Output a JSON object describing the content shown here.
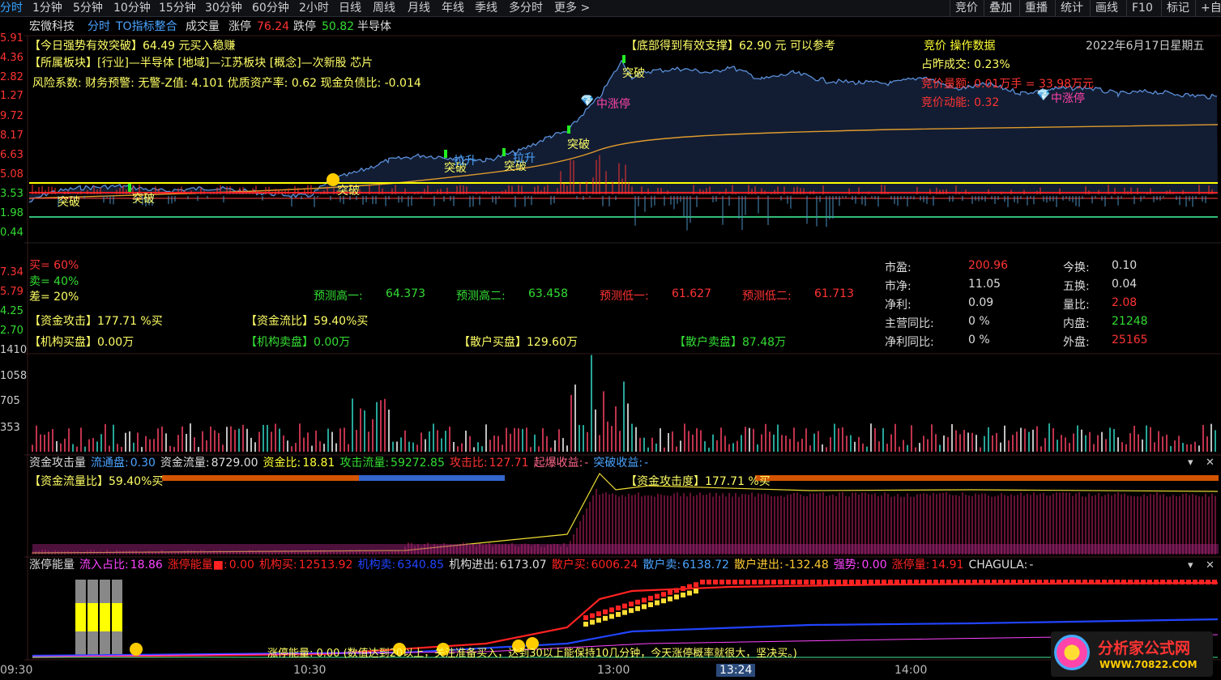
{
  "topbar": {
    "tabs": [
      "分时",
      "1分钟",
      "5分钟",
      "10分钟",
      "15分钟",
      "30分钟",
      "60分钟",
      "2小时",
      "日线",
      "周线",
      "月线",
      "年线",
      "季线",
      "多分时",
      "更多 >"
    ],
    "right_tools": [
      "竞价",
      "叠加",
      "重播",
      "统计",
      "画线",
      "F10",
      "标记",
      "+自"
    ]
  },
  "infobar": {
    "stock_name": "宏微科技",
    "fenshi": "分时",
    "indicator": "TO指标整合",
    "volume_label": "成交量",
    "limit_up_label": "涨停",
    "limit_up_value": "76.24",
    "limit_down_label": "跌停",
    "limit_down_value": "50.82",
    "sector": "半导体"
  },
  "main_chart": {
    "y_labels": [
      "5.91",
      "4.36",
      "2.82",
      "1.27",
      "9.72",
      "8.17",
      "6.63",
      "5.08",
      "3.53",
      "1.98",
      "0.44",
      "7.34",
      "5.79",
      "4.25",
      "2.70"
    ],
    "breakout_text": "【今日强势有效突破】64.49 元买入稳赚",
    "support_text": "【底部得到有效支撑】62.90 元 可以参考",
    "sector_text": "【所属板块】[行业]—半导体 [地域]—江苏板块 [概念]—次新股 芯片",
    "risk_text": "风险系数: 财务预警: 无警-Z值: 4.101 优质资产率: 0.62 现金负债比: -0.014",
    "bidding_title": "竞价 操作数据",
    "date": "2022年6月17日星期五",
    "bid_ratio": "占昨成交: 0.23%",
    "bid_amount": "竞价量额: 0.01万手 = 33.98万元",
    "bid_momentum": "竞价动能: 0.32",
    "markers": {
      "tupo": "突破",
      "lasheng": "拉升",
      "zhongzhangting": "中涨停"
    },
    "buy_pct": "买= 60%",
    "sell_pct": "卖= 40%",
    "diff_pct": "差= 20%",
    "forecast": [
      {
        "label": "预测高一:",
        "value": "64.373",
        "color": "#33dd33"
      },
      {
        "label": "预测高二:",
        "value": "63.458",
        "color": "#33dd33"
      },
      {
        "label": "预测低一:",
        "value": "61.627",
        "color": "#ff3333"
      },
      {
        "label": "预测低二:",
        "value": "61.713",
        "color": "#ff3333"
      }
    ],
    "stats": [
      {
        "label": "市盈:",
        "value": "200.96",
        "vcolor": "#ff3333",
        "label2": "今换:",
        "value2": "0.10",
        "v2color": "#dddddd"
      },
      {
        "label": "市净:",
        "value": "11.05",
        "vcolor": "#dddddd",
        "label2": "五换:",
        "value2": "0.04",
        "v2color": "#dddddd"
      },
      {
        "label": "净利:",
        "value": "0.09",
        "vcolor": "#dddddd",
        "label2": "量比:",
        "value2": "2.08",
        "v2color": "#ff3333"
      },
      {
        "label": "主营同比:",
        "value": "0 %",
        "vcolor": "#dddddd",
        "label2": "内盘:",
        "value2": "21248",
        "v2color": "#33dd33"
      },
      {
        "label": "净利同比:",
        "value": "0 %",
        "vcolor": "#dddddd",
        "label2": "外盘:",
        "value2": "25165",
        "v2color": "#ff3333"
      }
    ],
    "fund_attack": "【资金攻击】177.71 %买",
    "fund_flow_ratio": "【资金流比】59.40%买",
    "inst_buy": "【机构买盘】0.00万",
    "inst_sell": "【机构卖盘】0.00万",
    "retail_buy": "【散户买盘】129.60万",
    "retail_sell": "【散户卖盘】87.48万"
  },
  "volume_chart": {
    "y_labels": [
      "1410",
      "1058",
      "705",
      "353"
    ]
  },
  "attack_panel": {
    "title": "资金攻击量",
    "items": [
      {
        "label": "流通盘:",
        "value": "0.30",
        "lcolor": "#4aa3ff",
        "vcolor": "#4aa3ff"
      },
      {
        "label": "资金流量:",
        "value": "8729.00",
        "lcolor": "#dddddd",
        "vcolor": "#dddddd"
      },
      {
        "label": "资金比:",
        "value": "18.81",
        "lcolor": "#ffff33",
        "vcolor": "#ffff33"
      },
      {
        "label": "攻击流量:",
        "value": "59272.85",
        "lcolor": "#33dd33",
        "vcolor": "#33dd33"
      },
      {
        "label": "攻击比:",
        "value": "127.71",
        "lcolor": "#ff3333",
        "vcolor": "#ff3333"
      },
      {
        "label": "起爆收益:",
        "value": "-",
        "lcolor": "#ff6688",
        "vcolor": "#ff6688"
      },
      {
        "label": "突破收益:",
        "value": "-",
        "lcolor": "#4aa3ff",
        "vcolor": "#4aa3ff"
      }
    ],
    "flow_ratio_label": "【资金流量比】59.40%买",
    "attack_degree_label": "【资金攻击度】177.71 %买"
  },
  "limit_panel": {
    "title": "涨停能量",
    "items": [
      {
        "label": "流入占比:",
        "value": "18.86",
        "color": "#ff44ff"
      },
      {
        "label": "涨停能量■:",
        "value": "0.00",
        "color": "#ff2222"
      },
      {
        "label": "机构买:",
        "value": "12513.92",
        "color": "#ff2222"
      },
      {
        "label": "机构卖:",
        "value": "6340.85",
        "color": "#2244ff"
      },
      {
        "label": "机构进出:",
        "value": "6173.07",
        "color": "#dddddd"
      },
      {
        "label": "散户买:",
        "value": "6006.24",
        "color": "#ff2222"
      },
      {
        "label": "散户卖:",
        "value": "6138.72",
        "color": "#4aa3ff"
      },
      {
        "label": "散户进出:",
        "value": "-132.48",
        "color": "#ffcc33"
      },
      {
        "label": "强势:",
        "value": "0.00",
        "color": "#ff44ff"
      },
      {
        "label": "涨停量:",
        "value": "14.91",
        "color": "#ff2222"
      },
      {
        "label": "CHAGULA:",
        "value": "-",
        "color": "#dddddd"
      }
    ],
    "bottom_text": "涨停能量: 0.00 (数值达到20以上，关注准备买入，达到30以上能保持10几分钟，今天涨停概率就很大，坚决买。)"
  },
  "x_axis": {
    "labels": [
      "09:30",
      "10:30",
      "13:00",
      "13:24",
      "14:00"
    ]
  },
  "watermark": {
    "brand": "分析家公式网",
    "url": "WWW.70822.COM"
  },
  "colors": {
    "up": "#ff3333",
    "down": "#33dd33",
    "price_line": "#5b8fd8",
    "avg_line": "#e09b2d",
    "yellow": "#ffff00"
  }
}
